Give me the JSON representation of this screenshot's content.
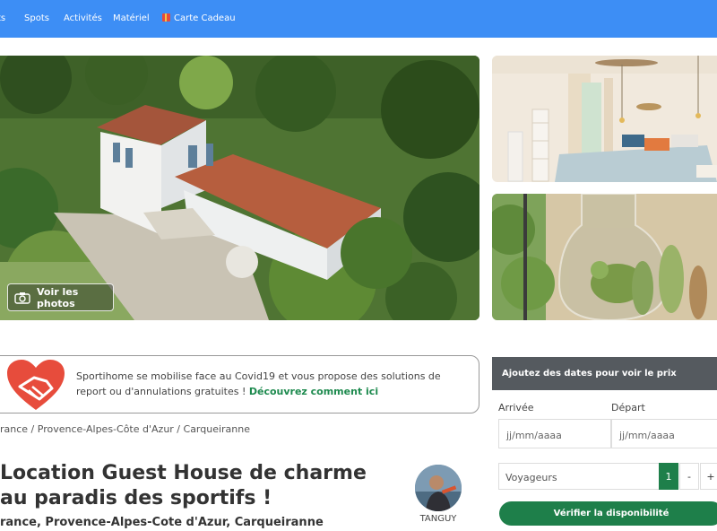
{
  "nav": {
    "items": [
      "ts",
      "Spots",
      "Activités",
      "Matériel"
    ],
    "gift_card": "Carte Cadeau",
    "background": "#3d8ef5"
  },
  "gallery": {
    "see_photos": "Voir les photos",
    "camera_icon": "camera-icon"
  },
  "covid": {
    "text": "Sportihome se mobilise face au Covid19 et vous propose des solutions de report ou d'annulations gratuites ! ",
    "link": "Découvrez comment ici",
    "icon": "heart-hands-icon",
    "accent": "#e74c3c"
  },
  "breadcrumb": "rance / Provence-Alpes-Côte d'Azur / Carqueiranne",
  "listing": {
    "title": "Location Guest House de charme au paradis des sportifs !",
    "location": "rance, Provence-Alpes-Cote d'Azur, Carqueiranne"
  },
  "host": {
    "name": "TANGUY"
  },
  "booking": {
    "header": "Ajoutez des dates pour voir le prix",
    "arrival_label": "Arrivée",
    "departure_label": "Départ",
    "arrival_placeholder": "jj/mm/aaaa",
    "departure_placeholder": "jj/mm/aaaa",
    "travellers_label": "Voyageurs",
    "travellers_count": "1",
    "minus": "-",
    "plus": "+",
    "check_button": "Vérifier la disponibilité",
    "accent": "#1e7f4a"
  }
}
